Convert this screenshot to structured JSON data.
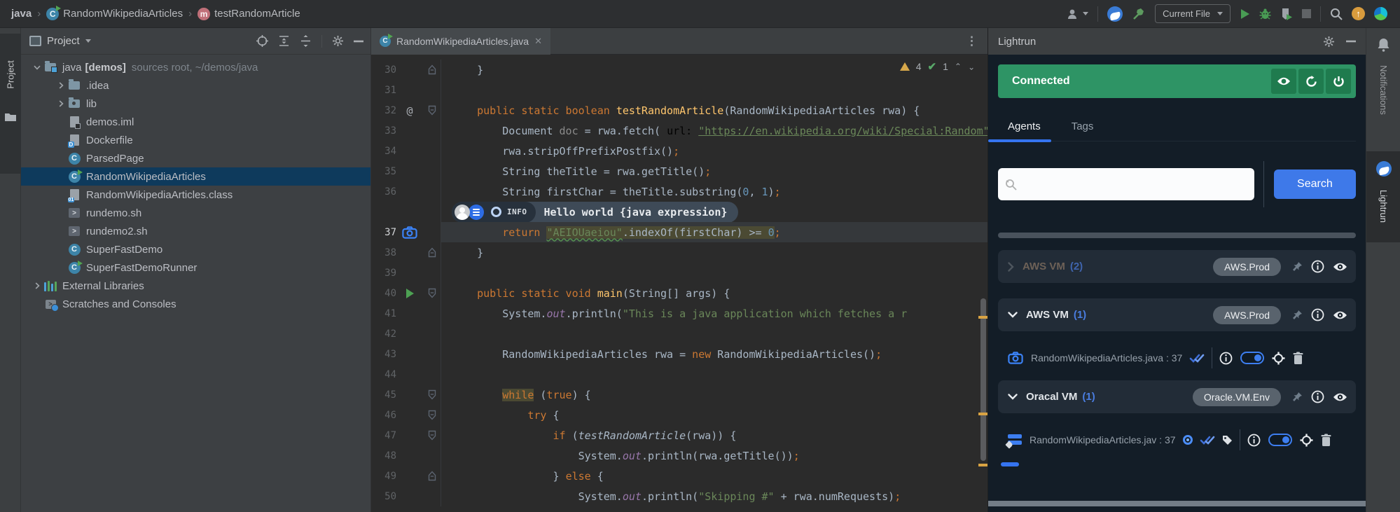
{
  "topbar": {
    "breadcrumbs": [
      {
        "label": "java",
        "icon": null
      },
      {
        "label": "RandomWikipediaArticles",
        "icon": "class-run-icon"
      },
      {
        "label": "testRandomArticle",
        "icon": "method-icon"
      }
    ],
    "run_config": "Current File"
  },
  "left_strip": {
    "label": "Project"
  },
  "right_strip": {
    "notifications_label": "Notifications",
    "lightrun_label": "Lightrun"
  },
  "project": {
    "title": "Project",
    "tree": [
      {
        "depth": 0,
        "chevron": "down",
        "icon": "folder-root",
        "label": "java",
        "badge": "[demos]",
        "extra": "sources root, ~/demos/java"
      },
      {
        "depth": 1,
        "chevron": "right",
        "icon": "folder",
        "label": ".idea"
      },
      {
        "depth": 1,
        "chevron": "right",
        "icon": "folder-lib",
        "label": "lib"
      },
      {
        "depth": 1,
        "chevron": null,
        "icon": "file-iml",
        "label": "demos.iml"
      },
      {
        "depth": 1,
        "chevron": null,
        "icon": "file-docker",
        "label": "Dockerfile"
      },
      {
        "depth": 1,
        "chevron": null,
        "icon": "class",
        "label": "ParsedPage"
      },
      {
        "depth": 1,
        "chevron": null,
        "icon": "class-run",
        "label": "RandomWikipediaArticles",
        "selected": true
      },
      {
        "depth": 1,
        "chevron": null,
        "icon": "file-class",
        "label": "RandomWikipediaArticles.class"
      },
      {
        "depth": 1,
        "chevron": null,
        "icon": "file-sh",
        "label": "rundemo.sh"
      },
      {
        "depth": 1,
        "chevron": null,
        "icon": "file-sh",
        "label": "rundemo2.sh"
      },
      {
        "depth": 1,
        "chevron": null,
        "icon": "class",
        "label": "SuperFastDemo"
      },
      {
        "depth": 1,
        "chevron": null,
        "icon": "class-run",
        "label": "SuperFastDemoRunner"
      },
      {
        "depth": 0,
        "chevron": "right",
        "icon": "ext-lib",
        "label": "External Libraries"
      },
      {
        "depth": 0,
        "chevron": null,
        "icon": "scratches",
        "label": "Scratches and Consoles"
      }
    ]
  },
  "editor": {
    "tab": "RandomWikipediaArticles.java",
    "inspections": {
      "warnings": "4",
      "ok": "1"
    },
    "widget": {
      "severity": "INFO",
      "text": "Hello world {java expression}"
    },
    "code": [
      {
        "n": "30",
        "fold": "end",
        "tokens": [
          [
            "p",
            "    }"
          ]
        ]
      },
      {
        "n": "31",
        "tokens": []
      },
      {
        "n": "32",
        "gut": "at",
        "fold": "start",
        "tokens": [
          [
            "k",
            "    public static boolean "
          ],
          [
            "m",
            "testRandomArticle"
          ],
          [
            "p",
            "(RandomWikipediaArticles rwa) {"
          ]
        ]
      },
      {
        "n": "33",
        "tokens": [
          [
            "p",
            "        Document "
          ],
          [
            "dim",
            "doc"
          ],
          [
            "p",
            " = rwa.fetch( "
          ],
          [
            "hint",
            "url:"
          ],
          [
            "p",
            " "
          ],
          [
            "slink",
            "\"https://en.wikipedia.org/wiki/Special:Random\""
          ]
        ]
      },
      {
        "n": "34",
        "tokens": [
          [
            "p",
            "        rwa.stripOffPrefixPostfix()"
          ],
          [
            "k",
            ";"
          ]
        ]
      },
      {
        "n": "35",
        "tokens": [
          [
            "p",
            "        String theTitle = rwa.getTitle()"
          ],
          [
            "k",
            ";"
          ]
        ]
      },
      {
        "n": "36",
        "tokens": [
          [
            "p",
            "        String firstChar = theTitle.substring("
          ],
          [
            "n",
            "0"
          ],
          [
            "p",
            ", "
          ],
          [
            "n",
            "1"
          ],
          [
            "p",
            ")"
          ],
          [
            "k",
            ";"
          ]
        ]
      },
      {
        "widget": true
      },
      {
        "n": "37",
        "gut": "camera",
        "cur": true,
        "tokens": [
          [
            "p",
            "        "
          ],
          [
            "k",
            "return "
          ],
          [
            "swavy hl",
            "\"AEIOUaeiou\""
          ],
          [
            "p hl",
            ".indexOf(firstChar) >= "
          ],
          [
            "n hl",
            "0"
          ],
          [
            "k",
            ";"
          ]
        ]
      },
      {
        "n": "38",
        "fold": "end",
        "tokens": [
          [
            "p",
            "    }"
          ]
        ]
      },
      {
        "n": "39",
        "tokens": []
      },
      {
        "n": "40",
        "gut": "run",
        "fold": "start",
        "tokens": [
          [
            "k",
            "    public static void "
          ],
          [
            "m",
            "main"
          ],
          [
            "p",
            "(String[] args) {"
          ]
        ]
      },
      {
        "n": "41",
        "tokens": [
          [
            "p",
            "        System."
          ],
          [
            "f",
            "out"
          ],
          [
            "p",
            ".println("
          ],
          [
            "s",
            "\"This is a java application which fetches a r"
          ]
        ]
      },
      {
        "n": "42",
        "tokens": []
      },
      {
        "n": "43",
        "tokens": [
          [
            "p",
            "        RandomWikipediaArticles rwa = "
          ],
          [
            "k",
            "new"
          ],
          [
            "p",
            " RandomWikipediaArticles()"
          ],
          [
            "k",
            ";"
          ]
        ]
      },
      {
        "n": "44",
        "tokens": []
      },
      {
        "n": "45",
        "fold": "start",
        "tokens": [
          [
            "p",
            "        "
          ],
          [
            "k hl",
            "while"
          ],
          [
            "p",
            " ("
          ],
          [
            "k",
            "true"
          ],
          [
            "p",
            ") {"
          ]
        ]
      },
      {
        "n": "46",
        "fold": "start",
        "tokens": [
          [
            "p",
            "            "
          ],
          [
            "k",
            "try"
          ],
          [
            "p",
            " {"
          ]
        ]
      },
      {
        "n": "47",
        "fold": "start",
        "tokens": [
          [
            "p",
            "                "
          ],
          [
            "k",
            "if"
          ],
          [
            "p",
            " ("
          ],
          [
            "i",
            "testRandomArticle"
          ],
          [
            "p",
            "(rwa)) {"
          ]
        ]
      },
      {
        "n": "48",
        "tokens": [
          [
            "p",
            "                    System."
          ],
          [
            "f",
            "out"
          ],
          [
            "p",
            ".println(rwa.getTitle())"
          ],
          [
            "k",
            ";"
          ]
        ]
      },
      {
        "n": "49",
        "fold": "end",
        "tokens": [
          [
            "p",
            "                } "
          ],
          [
            "k",
            "else"
          ],
          [
            "p",
            " {"
          ]
        ]
      },
      {
        "n": "50",
        "tokens": [
          [
            "p",
            "                    System."
          ],
          [
            "f",
            "out"
          ],
          [
            "p",
            ".println("
          ],
          [
            "s",
            "\"Skipping #\""
          ],
          [
            "p",
            " + rwa.numRequests)"
          ],
          [
            "k",
            ";"
          ]
        ]
      }
    ]
  },
  "lightrun": {
    "title": "Lightrun",
    "status": "Connected",
    "tabs": [
      {
        "label": "Agents",
        "active": true
      },
      {
        "label": "Tags",
        "active": false
      }
    ],
    "search_button": "Search",
    "search_value": "",
    "agents": [
      {
        "type": "agent",
        "disabled": true,
        "chevron": "right",
        "name": "AWS VM",
        "count": "(2)",
        "tag": "AWS.Prod"
      },
      {
        "type": "agent",
        "disabled": false,
        "chevron": "down",
        "name": "AWS VM",
        "count": "(1)",
        "tag": "AWS.Prod"
      },
      {
        "type": "action",
        "icon": "camera",
        "label": "RandomWikipediaArticles.java : 37",
        "left_icons": [
          "check"
        ],
        "right_icons": [
          "info",
          "toggle",
          "target",
          "trash"
        ]
      },
      {
        "type": "agent",
        "disabled": false,
        "chevron": "down",
        "name": "Oracal VM",
        "count": "(1)",
        "tag": "Oracle.VM.Env"
      },
      {
        "type": "action",
        "icon": "taglist",
        "label": "RandomWikipediaArticles.jav : 37",
        "left_icons": [
          "ring",
          "check",
          "tag"
        ],
        "right_icons": [
          "info",
          "toggle",
          "target",
          "trash"
        ]
      }
    ]
  }
}
